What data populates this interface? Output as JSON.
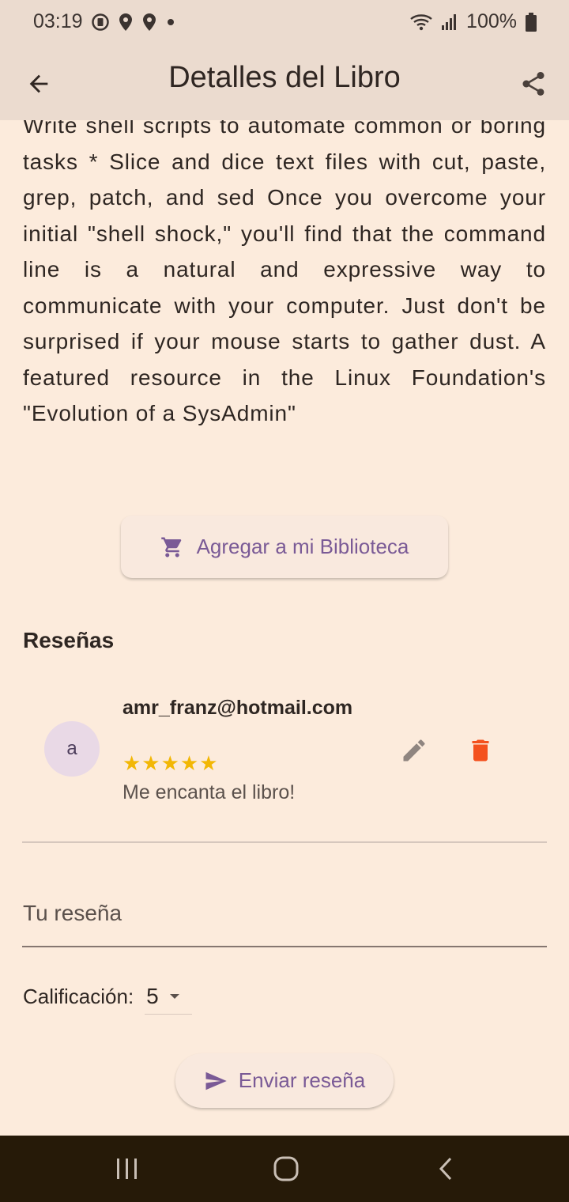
{
  "status_bar": {
    "time": "03:19",
    "battery": "100%",
    "icons": [
      "data-saver-icon",
      "location-icon",
      "location-icon",
      "dot-icon",
      "wifi-icon",
      "signal-icon",
      "battery-icon"
    ]
  },
  "app_bar": {
    "title": "Detalles del Libro",
    "back_icon": "arrow-back-icon",
    "share_icon": "share-icon"
  },
  "description": "Write shell scripts to automate common or boring tasks * Slice and dice text files with cut, paste, grep, patch, and sed Once you overcome your initial \"shell shock,\" you'll find that the command line is a natural and expressive way to communicate with your computer. Just don't be surprised if your mouse starts to gather dust. A featured resource in the Linux Foundation's \"Evolution of a SysAdmin\"",
  "library_button": {
    "label": "Agregar a mi Biblioteca",
    "icon": "cart-icon"
  },
  "reviews": {
    "title": "Reseñas",
    "items": [
      {
        "avatar_letter": "a",
        "email": "amr_franz@hotmail.com",
        "stars": "★★★★★",
        "rating": 5,
        "text": "Me encanta el libro!"
      }
    ]
  },
  "review_form": {
    "placeholder": "Tu reseña",
    "rating_label": "Calificación:",
    "rating_value": "5",
    "submit_label": "Enviar reseña",
    "submit_icon": "send-icon"
  },
  "colors": {
    "background": "#fcebdc",
    "app_bar": "#ebdbcf",
    "accent": "#7a5a96",
    "star": "#f2b705",
    "delete": "#f4511e",
    "nav_bar": "#261a08"
  }
}
